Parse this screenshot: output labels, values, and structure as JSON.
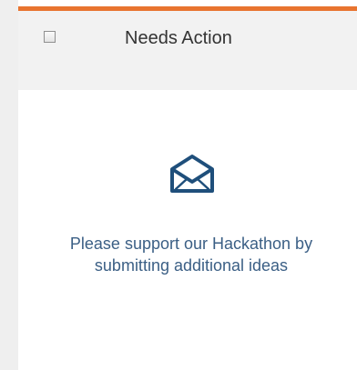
{
  "header": {
    "title": "Needs Action"
  },
  "empty_state": {
    "icon": "open-envelope-icon",
    "message": "Please support our Hackathon by submitting additional ideas"
  },
  "colors": {
    "accent": "#e8742f",
    "message_text": "#3b5f85",
    "icon": "#1f4f7b"
  }
}
